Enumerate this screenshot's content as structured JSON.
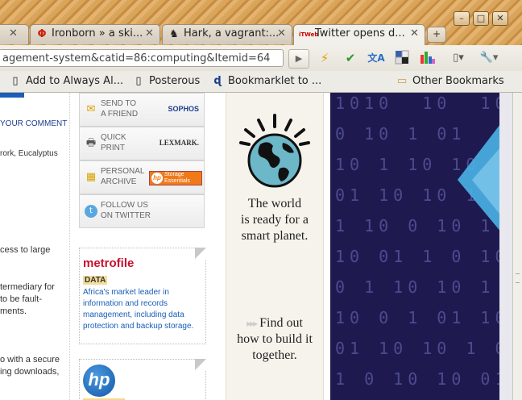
{
  "window": {
    "controls": [
      "–",
      "□",
      "✕"
    ]
  },
  "tabs": [
    {
      "title": "",
      "close": "✕"
    },
    {
      "title": "Ironborn » a ski...",
      "favicon": "Φ",
      "close": "✕"
    },
    {
      "title": "Hark, a vagrant:...",
      "favicon": "♞",
      "close": "✕"
    },
    {
      "title": "Twitter opens d...",
      "favicon": "iTWeb",
      "close": "✕"
    }
  ],
  "new_tab_symbol": "+",
  "toolbar": {
    "url": "agement-system&catid=86:computing&Itemid=64",
    "go_symbol": "▶"
  },
  "bookmarks": [
    {
      "label": "Add to Always Al..."
    },
    {
      "label": "Posterous"
    },
    {
      "label": "Bookmarklet to ..."
    },
    {
      "label": "Other Bookmarks"
    }
  ],
  "left_column_text": [
    {
      "text": "YOUR COMMENT"
    },
    {
      "text": "rork, Eucalyptus"
    },
    {
      "text": "cess to large"
    },
    {
      "text": "termediary for"
    },
    {
      "text": "to be fault-"
    },
    {
      "text": "ments."
    },
    {
      "text": "o with a secure"
    },
    {
      "text": "ing downloads,"
    }
  ],
  "sidebar_tools": [
    {
      "line1": "SEND TO",
      "line2": "A FRIEND",
      "sponsor": "SOPHOS"
    },
    {
      "line1": "QUICK",
      "line2": "PRINT",
      "sponsor": "LEXMARK."
    },
    {
      "line1": "PERSONAL",
      "line2": "ARCHIVE",
      "sponsor": "Storage Essentials"
    },
    {
      "line1": "FOLLOW US",
      "line2": "ON TWITTER",
      "sponsor": ""
    }
  ],
  "metrofile_promo": {
    "logo": "metrofile",
    "tag": "DATA",
    "text": "Africa's market leader in information and records management, including data protection and backup storage."
  },
  "hp_promo": {
    "logo": "hp"
  },
  "ibm_ad": {
    "line1": "The world",
    "line2": "is ready for a",
    "line3": "smart planet.",
    "cta1": "Find out",
    "cta2": "how to build it",
    "cta3": "together.",
    "arrows": "▸▸▸"
  },
  "colors": {
    "metrofile_red": "#c8102e",
    "link_blue": "#1a5eb8",
    "ad_dark": "#1e1a50",
    "ad_accent": "#4ab3e6"
  }
}
